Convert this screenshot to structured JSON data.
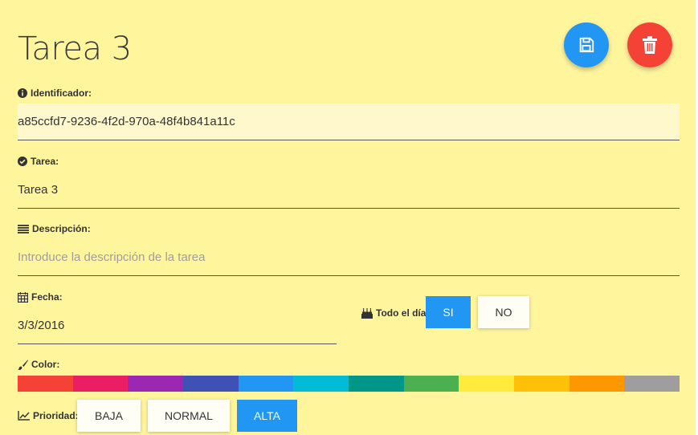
{
  "title": "Tarea 3",
  "actions": {
    "save_color": "#2196f3",
    "delete_color": "#f44336"
  },
  "identificador": {
    "label": "Identificador:",
    "value": "a85ccfd7-9236-4f2d-970a-48f4b841a11c"
  },
  "tarea": {
    "label": "Tarea:",
    "value": "Tarea 3"
  },
  "descripcion": {
    "label": "Descripción:",
    "placeholder": "Introduce la descripción de la tarea",
    "value": ""
  },
  "fecha": {
    "label": "Fecha:",
    "value": "3/3/2016"
  },
  "todo_el_dia": {
    "label": "Todo el día:",
    "options": [
      "SI",
      "NO"
    ],
    "selected": "SI"
  },
  "color": {
    "label": "Color:",
    "swatches": [
      "#f44336",
      "#e91e63",
      "#9c27b0",
      "#3f51b5",
      "#2196f3",
      "#00bcd4",
      "#009688",
      "#4caf50",
      "#ffeb3b",
      "#ffc107",
      "#ff9800",
      "#9e9e9e"
    ]
  },
  "prioridad": {
    "label": "Prioridad:",
    "options": [
      "BAJA",
      "NORMAL",
      "ALTA"
    ],
    "selected": "ALTA"
  },
  "theme": {
    "card_background": "#fff59d",
    "accent": "#2196f3"
  }
}
